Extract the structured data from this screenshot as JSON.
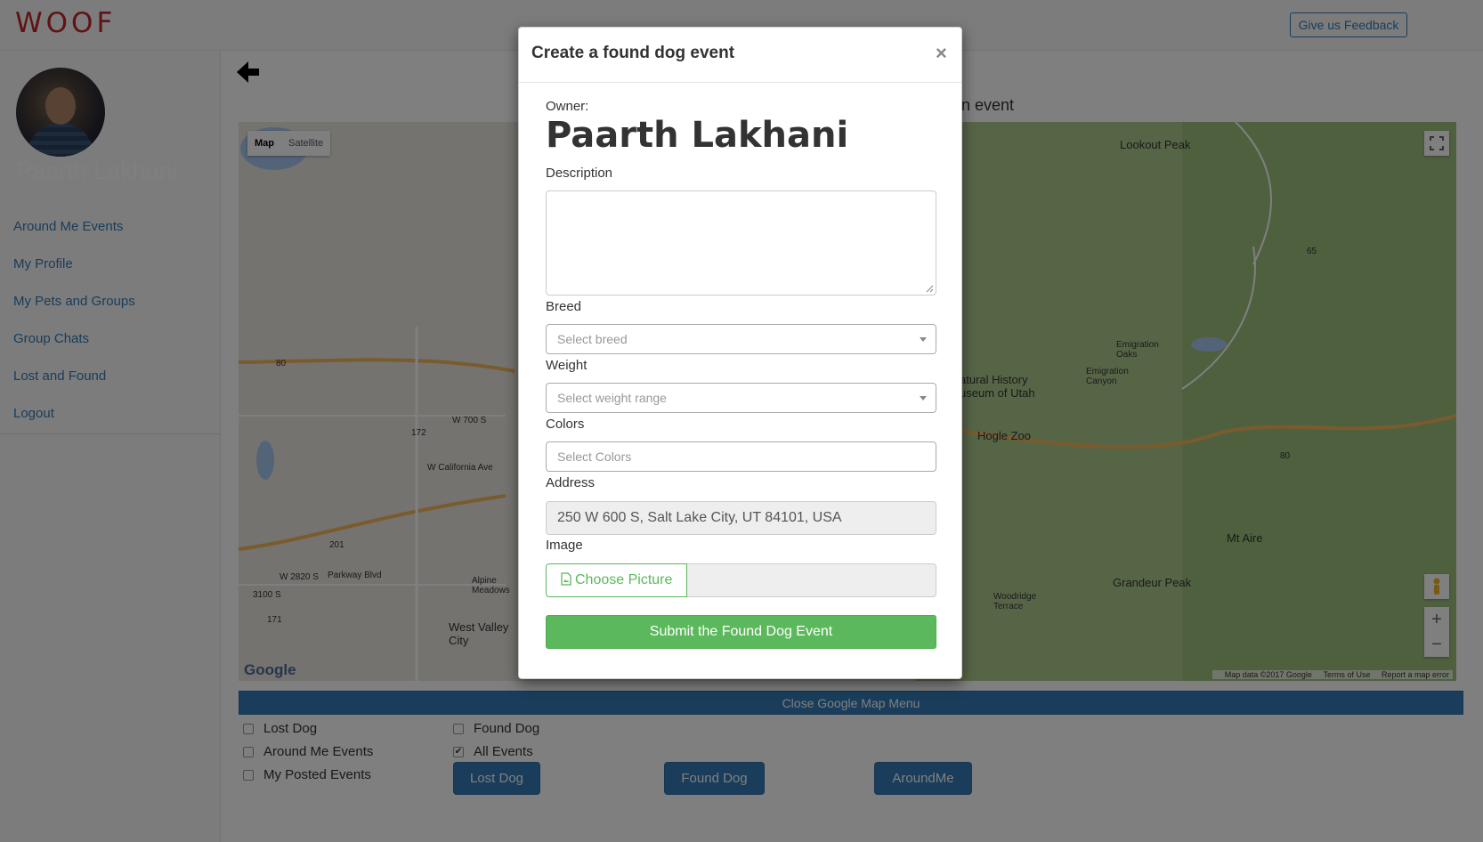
{
  "topbar": {
    "logo": "WOOF",
    "feedback_label": "Give us Feedback"
  },
  "sidebar": {
    "profile_name": "Paarth Lakhani",
    "items": [
      {
        "label": "Around Me Events"
      },
      {
        "label": "My Profile"
      },
      {
        "label": "My Pets and Groups"
      },
      {
        "label": "Group Chats"
      },
      {
        "label": "Lost and Found"
      },
      {
        "label": "Logout"
      }
    ]
  },
  "main": {
    "heading_partial": "an event",
    "map": {
      "type_map": "Map",
      "type_satellite": "Satellite",
      "zoom_in": "+",
      "zoom_out": "−",
      "google": "Google",
      "footer": {
        "data": "Map data ©2017 Google",
        "terms": "Terms of Use",
        "report": "Report a map error"
      },
      "labels": {
        "lookout_peak": "Lookout Peak",
        "emigration_oaks": "Emigration Oaks",
        "emigration_canyon": "Emigration Canyon",
        "natural_history": "atural History useum of Utah",
        "hogle_zoo": "Hogle Zoo",
        "mt_aire": "Mt Aire",
        "grandeur_peak": "Grandeur Peak",
        "woodridge": "Woodridge Terrace",
        "west_valley": "West Valley City",
        "alpine_meadows": "Alpine Meadows",
        "w700s": "W 700 S",
        "wcalifornia": "W California Ave",
        "parkway": "Parkway Blvd",
        "w2820s": "W 2820 S",
        "r3100s": "3100 S",
        "hwy80": "80",
        "hwy172": "172",
        "hwy201": "201",
        "hwy171": "171",
        "hwy65": "65"
      }
    },
    "close_map_label": "Close Google Map Menu",
    "filters": {
      "lost_dog": "Lost Dog",
      "around_me_events": "Around Me Events",
      "my_posted_events": "My Posted Events",
      "found_dog": "Found Dog",
      "all_events": "All Events",
      "all_events_checked": true
    },
    "buttons": {
      "lost_dog": "Lost Dog",
      "found_dog": "Found Dog",
      "around_me": "AroundMe"
    }
  },
  "modal": {
    "title": "Create a found dog event",
    "close": "×",
    "owner_label": "Owner:",
    "owner_name": "Paarth Lakhani",
    "description_label": "Description",
    "breed_label": "Breed",
    "breed_placeholder": "Select breed",
    "weight_label": "Weight",
    "weight_placeholder": "Select weight range",
    "colors_label": "Colors",
    "colors_placeholder": "Select Colors",
    "address_label": "Address",
    "address_value": "250 W 600 S, Salt Lake City, UT 84101, USA",
    "image_label": "Image",
    "choose_picture": "Choose Picture",
    "submit_label": "Submit the Found Dog Event"
  }
}
